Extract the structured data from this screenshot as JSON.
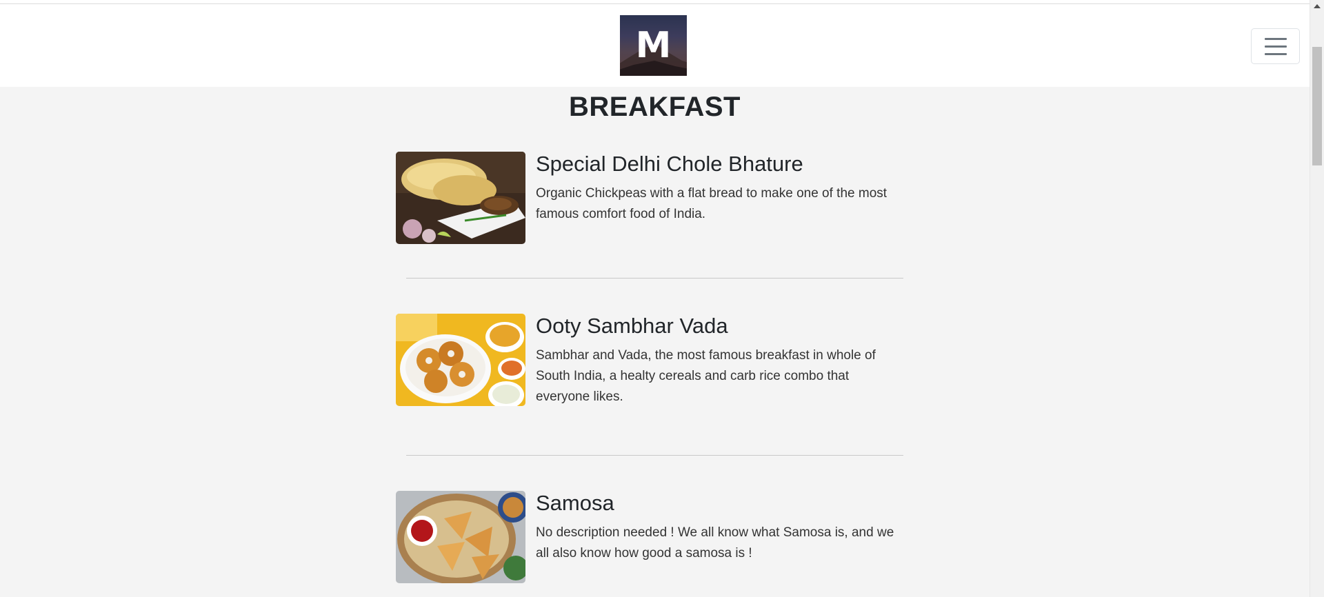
{
  "header": {
    "logo_text": "M",
    "menu_toggle_icon": "hamburger-menu-icon"
  },
  "page": {
    "title": "BREAKFAST"
  },
  "menu": {
    "items": [
      {
        "name": "Special Delhi Chole Bhature",
        "description": "Organic Chickpeas with a flat bread to make one of the most famous comfort food of India."
      },
      {
        "name": "Ooty Sambhar Vada",
        "description": "Sambhar and Vada, the most famous breakfast in whole of South India, a healty cereals and carb rice combo that everyone likes."
      },
      {
        "name": "Samosa",
        "description": "No description needed ! We all know what Samosa is, and we all also know how good a samosa is !"
      }
    ]
  },
  "colors": {
    "page_background": "#f4f4f4",
    "navbar_background": "#ffffff",
    "text": "#212529"
  }
}
